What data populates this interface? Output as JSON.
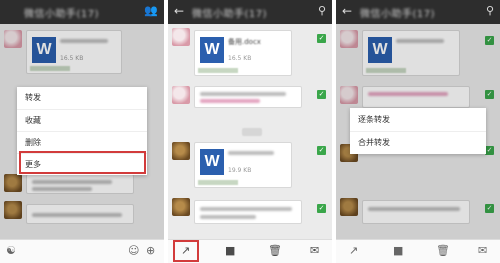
{
  "screen1": {
    "title": "微信小助手(17)",
    "file": {
      "name": "",
      "size": "16.5 KB"
    },
    "context_menu": [
      "转发",
      "收藏",
      "删除",
      "更多"
    ],
    "bottom_icons": [
      "voice-icon",
      "emoji-icon",
      "plus-icon"
    ]
  },
  "screen2": {
    "title": "微信小助手(17)",
    "file1": {
      "name": "备用.docx",
      "size": "16.5 KB"
    },
    "file2": {
      "name": "",
      "size": "19.9 KB"
    },
    "bottom_icons": [
      "share-icon",
      "cube-icon",
      "trash-icon",
      "mail-icon"
    ]
  },
  "screen3": {
    "title": "微信小助手(17)",
    "forward_menu": [
      "逐条转发",
      "合并转发"
    ],
    "bottom_icons": [
      "share-icon",
      "cube-icon",
      "trash-icon",
      "mail-icon"
    ]
  },
  "colors": {
    "accent_green": "#3aa64a",
    "highlight_red": "#d23b3b",
    "word_blue": "#2b5fae",
    "topbar": "#2d2d2d"
  }
}
